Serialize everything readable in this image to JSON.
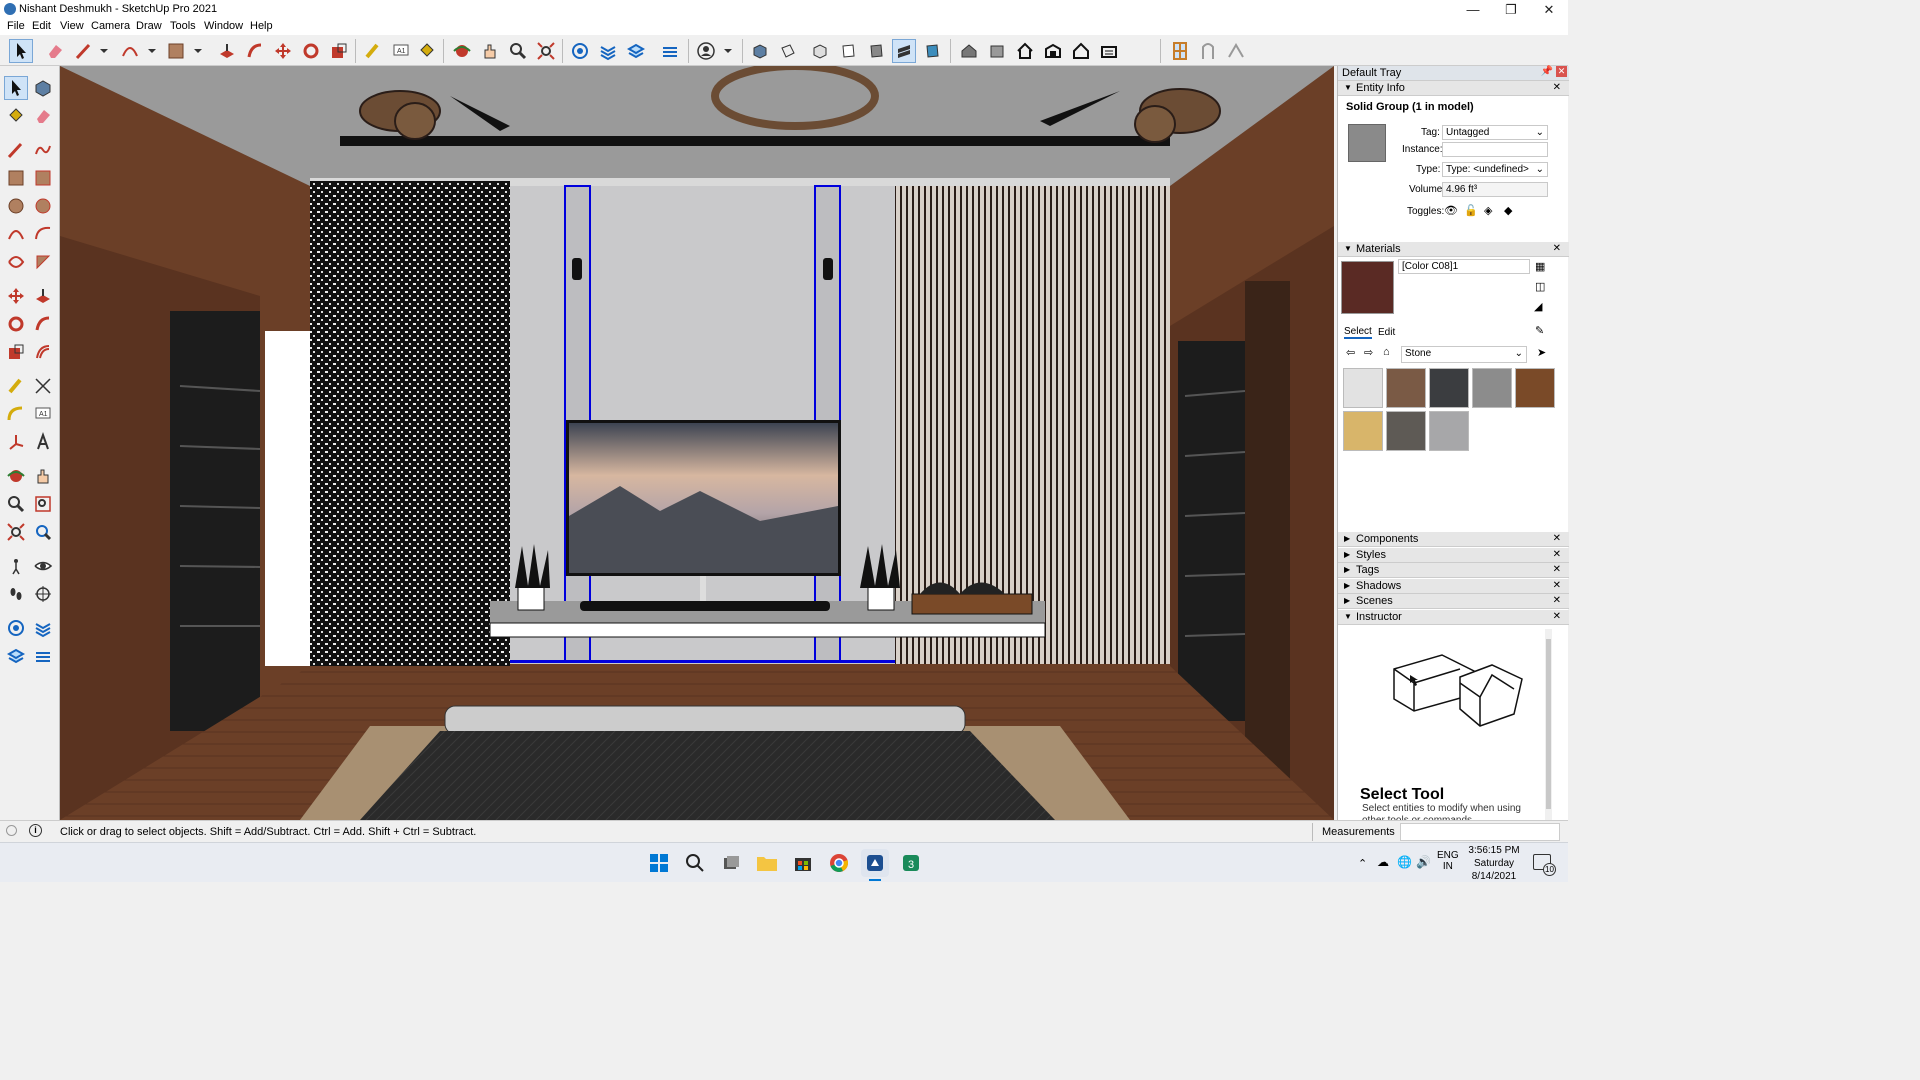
{
  "window": {
    "title": "Nishant Deshmukh - SketchUp Pro 2021"
  },
  "menu": [
    "File",
    "Edit",
    "View",
    "Camera",
    "Draw",
    "Tools",
    "Window",
    "Help"
  ],
  "toolbar": {
    "icons": [
      "select-icon",
      "eraser-icon",
      "line-icon",
      "arc-icon",
      "rectangle-icon",
      "push-pull-icon",
      "follow-me-icon",
      "move-icon",
      "rotate-icon",
      "scale-icon",
      "tape-measure-icon",
      "text-icon",
      "paint-bucket-icon",
      "orbit-icon",
      "pan-icon",
      "zoom-icon",
      "zoom-extents-icon",
      "outliner-icon",
      "section-plane-icon",
      "layers-icon",
      "user-icon",
      "iso-view-icon",
      "top-view-icon",
      "front-view-icon",
      "right-view-icon",
      "back-view-icon",
      "left-view-icon",
      "x-ray-icon",
      "wireframe-icon",
      "hidden-line-icon",
      "shaded-icon",
      "textured-icon",
      "house-1-icon",
      "house-2-icon",
      "home-icon",
      "warehouse-icon",
      "house-outline-icon",
      "garage-icon",
      "window-icon",
      "door-icon",
      "trim-icon"
    ]
  },
  "tray": {
    "title": "Default Tray",
    "entity_info": {
      "header": "Entity Info",
      "object": "Solid Group (1 in model)",
      "tag_label": "Tag:",
      "tag_value": "Untagged",
      "instance_label": "Instance:",
      "instance_value": "",
      "type_label": "Type:",
      "type_value": "Type: <undefined>",
      "volume_label": "Volume:",
      "volume_value": "4.96 ft³",
      "toggles_label": "Toggles:"
    },
    "materials": {
      "header": "Materials",
      "name": "[Color C08]1",
      "color": "#5a2a24",
      "tab_select": "Select",
      "tab_edit": "Edit",
      "library": "Stone",
      "swatches": [
        "#e2e2e2",
        "#7a5a45",
        "#3b3d40",
        "#8c8c8c",
        "#7a4a28",
        "#d8b56a",
        "#5e5a55",
        "#a7a7a9"
      ]
    },
    "panels": [
      "Components",
      "Styles",
      "Tags",
      "Shadows",
      "Scenes",
      "Instructor"
    ],
    "instructor": {
      "title": "Select Tool",
      "text": "Select entities to modify when using other tools or commands."
    }
  },
  "status": {
    "hint": "Click or drag to select objects. Shift = Add/Subtract. Ctrl = Add. Shift + Ctrl = Subtract.",
    "measurements": "Measurements"
  },
  "taskbar": {
    "lang1": "ENG",
    "lang2": "IN",
    "time": "3:56:15 PM",
    "day": "Saturday",
    "date": "8/14/2021",
    "notifications": "10"
  }
}
